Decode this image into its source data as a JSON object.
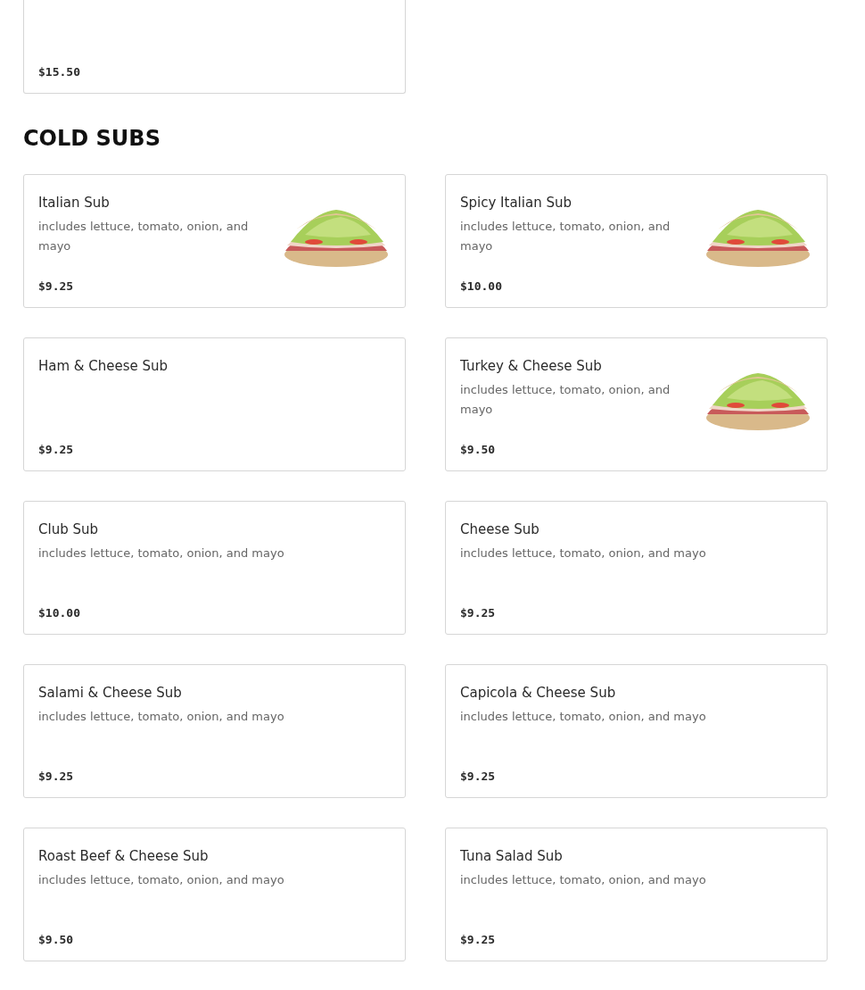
{
  "previous_item": {
    "price": "$15.50"
  },
  "section": {
    "title": "COLD SUBS",
    "items": [
      {
        "name": "Italian Sub",
        "description": "includes lettuce, tomato, onion, and mayo",
        "price": "$9.25",
        "has_picture": true
      },
      {
        "name": "Spicy Italian Sub",
        "description": "includes lettuce, tomato, onion, and mayo",
        "price": "$10.00",
        "has_picture": true
      },
      {
        "name": "Ham & Cheese Sub",
        "price": "$9.25",
        "has_picture": false
      },
      {
        "name": "Turkey & Cheese Sub",
        "description": "includes lettuce, tomato, onion, and mayo",
        "price": "$9.50",
        "has_picture": true
      },
      {
        "name": "Club Sub",
        "description": "includes lettuce, tomato, onion, and mayo",
        "price": "$10.00",
        "has_picture": false
      },
      {
        "name": "Cheese Sub",
        "description": "includes lettuce, tomato, onion, and mayo",
        "price": "$9.25",
        "has_picture": false
      },
      {
        "name": "Salami & Cheese Sub",
        "description": "includes lettuce, tomato, onion, and mayo",
        "price": "$9.25",
        "has_picture": false
      },
      {
        "name": "Capicola & Cheese Sub",
        "description": "includes lettuce, tomato, onion, and mayo",
        "price": "$9.25",
        "has_picture": false
      },
      {
        "name": "Roast Beef & Cheese Sub",
        "description": "includes lettuce, tomato, onion, and mayo",
        "price": "$9.50",
        "has_picture": false
      },
      {
        "name": "Tuna Salad Sub",
        "description": "includes lettuce, tomato, onion, and mayo",
        "price": "$9.25",
        "has_picture": false
      }
    ]
  }
}
